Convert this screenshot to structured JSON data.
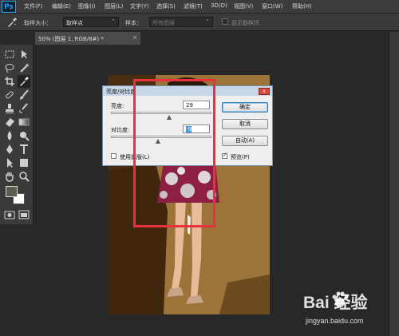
{
  "app": {
    "logo": "Ps"
  },
  "menu": [
    "文件(F)",
    "编辑(E)",
    "图像(I)",
    "图层(L)",
    "文字(Y)",
    "选择(S)",
    "滤镜(T)",
    "3D(D)",
    "视图(V)",
    "窗口(W)",
    "帮助(H)"
  ],
  "options": {
    "sample_size_label": "取样大小：",
    "sample_size_value": "取样点",
    "sample_label": "样本：",
    "sample_value": "所有图层",
    "show_ring_label": "显示取样环"
  },
  "document_tab": {
    "title": "50% (图层 1, RGB/8#) *",
    "close": "×"
  },
  "dialog": {
    "title": "亮度/对比度",
    "close": "x",
    "brightness_label": "亮度:",
    "brightness_value": "29",
    "brightness_fraction": 0.58,
    "contrast_label": "对比度:",
    "contrast_value": "-9",
    "contrast_fraction": 0.47,
    "ok_label": "确定",
    "cancel_label": "取消",
    "auto_label": "自动(A)",
    "legacy_label": "使用旧版(L)",
    "legacy_checked": false,
    "preview_label": "预览(P)",
    "preview_checked": true
  },
  "watermark": {
    "brand": "Bai  经验",
    "url": "jingyan.baidu.com"
  },
  "colors": {
    "accent": "#31a8ff",
    "highlight": "#e8333d",
    "canvas": "#9b7137",
    "dialog_title": "#c7d6e8"
  },
  "icons": [
    "eyedropper-icon",
    "move-icon",
    "marquee-icon",
    "lasso-icon",
    "magic-wand-icon",
    "crop-icon",
    "healing-icon",
    "brush-icon",
    "stamp-icon",
    "history-brush-icon",
    "eraser-icon",
    "gradient-icon",
    "blur-icon",
    "dodge-icon",
    "pen-icon",
    "type-icon",
    "path-select-icon",
    "shape-icon",
    "hand-icon",
    "zoom-icon",
    "color-swatch-icon",
    "quick-mask-icon",
    "screen-mode-icon"
  ]
}
